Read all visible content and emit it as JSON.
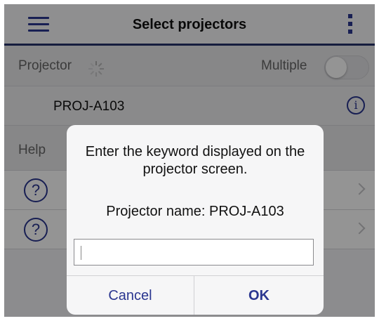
{
  "header": {
    "title": "Select projectors",
    "menu_icon": "hamburger-menu-icon",
    "more_icon": "vertical-dots-icon",
    "accent_color": "#2a3690"
  },
  "projector_row": {
    "label": "Projector",
    "loading_icon": "spinner-icon",
    "multiple_label": "Multiple",
    "multiple_enabled": false
  },
  "projector_list": [
    {
      "name": "PROJ-A103",
      "info_icon": "info-icon"
    }
  ],
  "help_section": {
    "label": "Help",
    "items": [
      {
        "icon": "question-circle-icon",
        "label": ""
      },
      {
        "icon": "question-circle-icon",
        "label": ""
      }
    ]
  },
  "dialog": {
    "message": "Enter the keyword displayed on the projector screen.",
    "projector_name": "Projector name: PROJ-A103",
    "input_value": "",
    "cancel_label": "Cancel",
    "ok_label": "OK"
  }
}
